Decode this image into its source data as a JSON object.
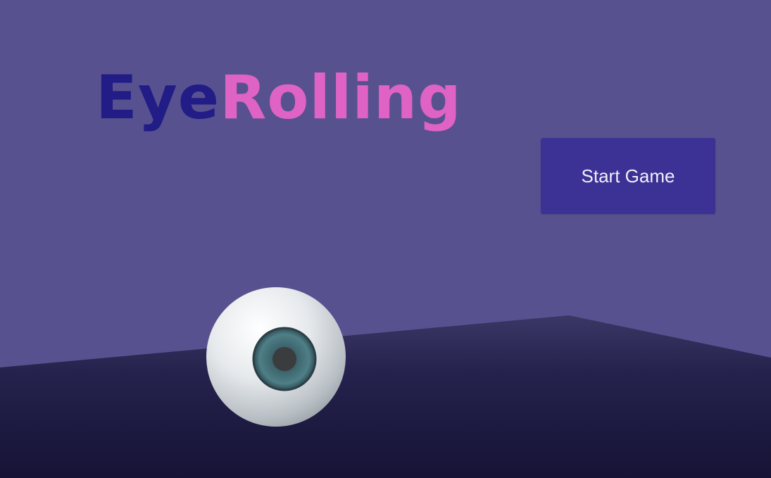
{
  "game": {
    "title_part1": "Eye",
    "title_part2": "Rolling",
    "start_button_label": "Start Game"
  },
  "colors": {
    "background": "#58518f",
    "floor": "#221f48",
    "title_eye": "#221c86",
    "title_rolling": "#de63c4",
    "button": "#3c3195",
    "button_text": "#f1f0f8"
  },
  "icons": {
    "eyeball": "eyeball-icon"
  }
}
